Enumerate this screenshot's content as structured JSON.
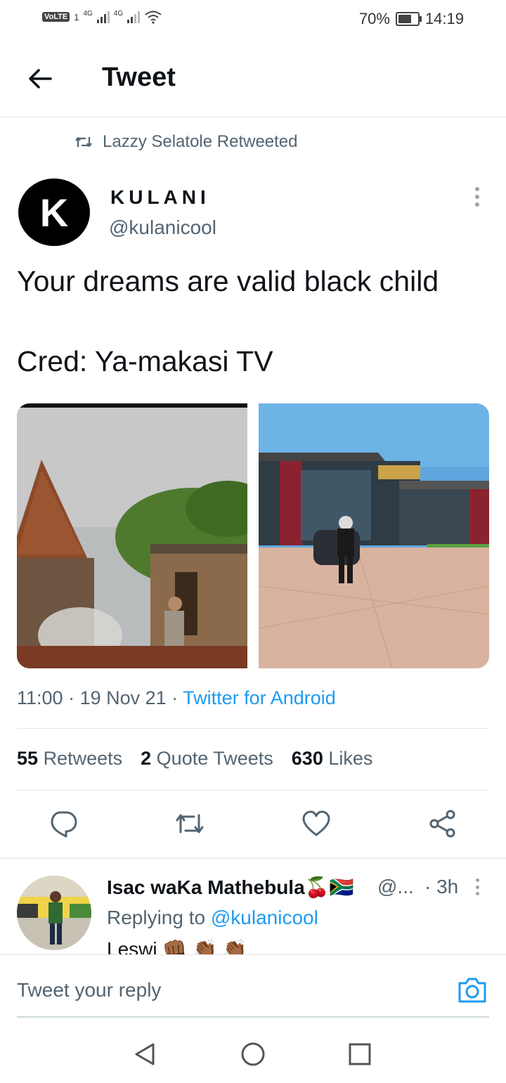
{
  "status_bar": {
    "volte": "VoLTE",
    "sim1": "1",
    "net1": "4G",
    "net2": "4G",
    "battery": "70%",
    "time": "14:19"
  },
  "header": {
    "title": "Tweet"
  },
  "retweet_context": {
    "text": "Lazzy Selatole Retweeted"
  },
  "tweet": {
    "avatar_letter": "K",
    "author_name": "KULANI",
    "author_handle": "@kulanicool",
    "text": "Your dreams are valid black child\n\nCred: Ya-makasi TV",
    "time": "11:00",
    "date": "19 Nov 21",
    "source": "Twitter for Android",
    "stats": {
      "retweets_count": "55",
      "retweets_label": "Retweets",
      "quotes_count": "2",
      "quotes_label": "Quote Tweets",
      "likes_count": "630",
      "likes_label": "Likes"
    }
  },
  "reply": {
    "name": "Isac waKa Mathebula🍒🇿🇦",
    "handle": "@...",
    "time": "· 3h",
    "replying_prefix": "Replying to",
    "replying_to": "@kulanicool",
    "body": "Leswi 👊🏾 👏🏾 👏🏾"
  },
  "compose": {
    "placeholder": "Tweet your reply"
  },
  "colors": {
    "link": "#1d9bf0",
    "secondary": "#536471"
  },
  "icons": [
    "back-arrow-icon",
    "retweet-icon",
    "more-icon",
    "reply-icon",
    "like-icon",
    "share-icon",
    "camera-icon",
    "nav-back-icon",
    "nav-home-icon",
    "nav-recents-icon"
  ]
}
